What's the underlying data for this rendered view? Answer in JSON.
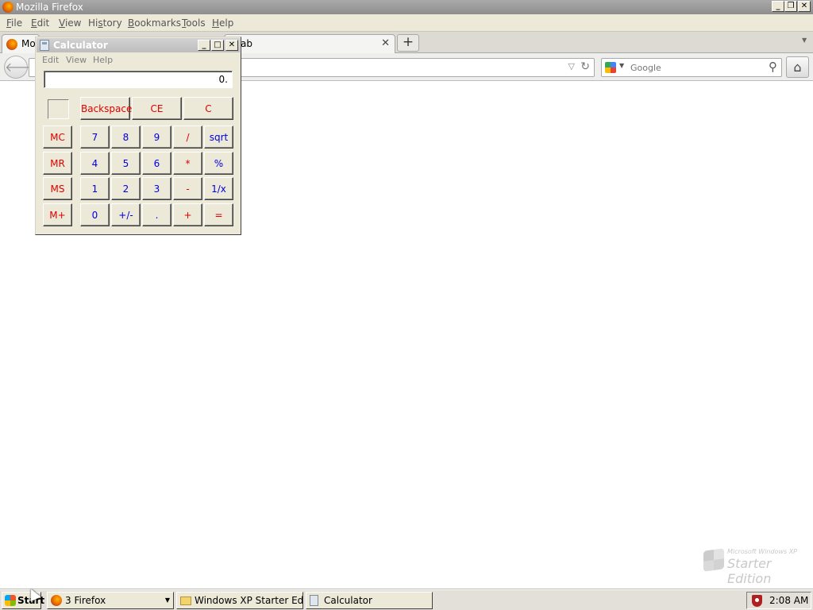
{
  "firefox": {
    "window_title": "Mozilla Firefox",
    "menu": [
      "File",
      "Edit",
      "View",
      "History",
      "Bookmarks",
      "Tools",
      "Help"
    ],
    "menu_mnemonics": [
      "F",
      "E",
      "V",
      "s",
      "B",
      "T",
      "H"
    ],
    "tabs": [
      {
        "label": "Mozil"
      },
      {
        "label": "ab"
      }
    ],
    "new_tab_label": "+",
    "search": {
      "placeholder": "Google"
    },
    "watermark": {
      "line1": "Microsoft Windows XP",
      "line2": "Starter Edition"
    },
    "window_buttons": {
      "minimize": "_",
      "restore": "❐",
      "close": "✕"
    }
  },
  "calculator": {
    "title": "Calculator",
    "menu": [
      "Edit",
      "View",
      "Help"
    ],
    "display": "0.",
    "window_buttons": {
      "minimize": "_",
      "maximize": "□",
      "close": "✕"
    },
    "keys": {
      "backspace": "Backspace",
      "ce": "CE",
      "c": "C",
      "mc": "MC",
      "mr": "MR",
      "ms": "MS",
      "mplus": "M+",
      "n7": "7",
      "n8": "8",
      "n9": "9",
      "divide": "/",
      "sqrt": "sqrt",
      "n4": "4",
      "n5": "5",
      "n6": "6",
      "multiply": "*",
      "percent": "%",
      "n1": "1",
      "n2": "2",
      "n3": "3",
      "minus": "-",
      "reciprocal": "1/x",
      "n0": "0",
      "sign": "+/-",
      "decimal": ".",
      "plus": "+",
      "equals": "="
    }
  },
  "taskbar": {
    "start_label": "Start",
    "buttons": [
      {
        "label": "3 Firefox"
      },
      {
        "label": "Windows XP Starter Edition"
      },
      {
        "label": "Calculator"
      }
    ],
    "clock": "2:08 AM"
  },
  "icons": {
    "firefox": "firefox-icon",
    "calculator": "calculator-icon",
    "folder": "folder-icon",
    "search": "magnifier-icon",
    "home": "home-icon",
    "back": "back-arrow-icon",
    "reload": "reload-icon",
    "shield": "security-shield-icon"
  },
  "colors": {
    "calc_digit": "#0000e0",
    "calc_operator": "#e00000",
    "window_face": "#ece9d8"
  }
}
